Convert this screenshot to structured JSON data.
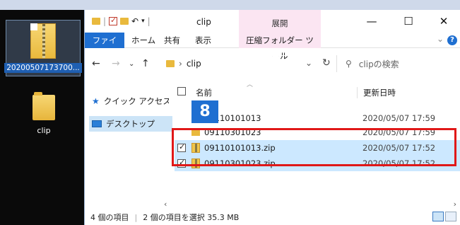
{
  "desktop": {
    "zip_label": "20200507173700...",
    "folder_label": "clip"
  },
  "window": {
    "title": "clip",
    "contextual_tab_header": "展開",
    "ribbon_tabs": [
      "ファイル",
      "ホーム",
      "共有",
      "表示",
      "圧縮フォルダー ツール"
    ],
    "controls": {
      "minimize": "—",
      "maximize": "☐",
      "close": "✕"
    }
  },
  "address": {
    "path": "clip",
    "search_placeholder": "clipの検索"
  },
  "nav_pane": {
    "items": [
      {
        "label": "クイック アクセス"
      },
      {
        "label": "デスクトップ"
      }
    ]
  },
  "file_list": {
    "columns": {
      "name": "名前",
      "modified": "更新日時"
    },
    "rows": [
      {
        "name": "09110101013",
        "date": "2020/05/07 17:59",
        "type": "folder",
        "selected": false
      },
      {
        "name": "09110301023",
        "date": "2020/05/07 17:59",
        "type": "folder",
        "selected": false
      },
      {
        "name": "09110101013.zip",
        "date": "2020/05/07 17:52",
        "type": "zip",
        "selected": true
      },
      {
        "name": "09110301023.zip",
        "date": "2020/05/07 17:52",
        "type": "zip",
        "selected": true
      }
    ]
  },
  "annotation": {
    "step_number": "8"
  },
  "status": {
    "item_count": "4 個の項目",
    "selection": "2 個の項目を選択 35.3 MB"
  },
  "colors": {
    "ribbon_file_tab": "#1f6fd1",
    "contextual_tab": "#fbe5f2",
    "selection": "#cce8ff",
    "highlight_border": "#e01818",
    "badge": "#1f6fd1"
  }
}
